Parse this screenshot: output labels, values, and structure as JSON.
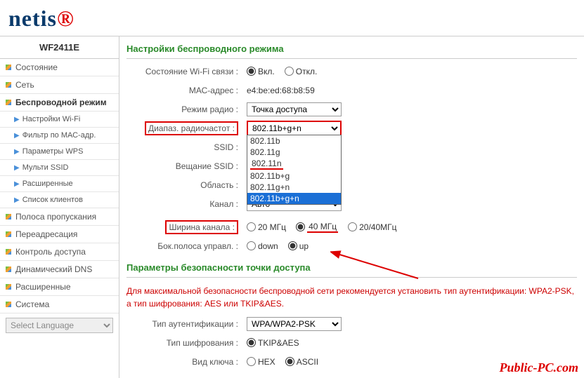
{
  "logo": {
    "text": "netis"
  },
  "model": "WF2411E",
  "nav": {
    "status": "Состояние",
    "network": "Сеть",
    "wireless": "Беспроводной режим",
    "wifi_settings": "Настройки Wi-Fi",
    "mac_filter": "Фильтр по МАС-адр.",
    "wps": "Параметры WPS",
    "multi_ssid": "Мульти SSID",
    "advanced_w": "Расширенные",
    "clients": "Список клиентов",
    "bandwidth": "Полоса пропускания",
    "forwarding": "Переадресация",
    "access": "Контроль доступа",
    "ddns": "Динамический DNS",
    "advanced": "Расширенные",
    "system": "Система"
  },
  "lang_placeholder": "Select Language",
  "sec_wireless": "Настройки беспроводного режима",
  "labels": {
    "wifi_state": "Состояние Wi-Fi связи :",
    "mac": "МАС-адрес :",
    "radio_mode": "Режим радио :",
    "band": "Диапаз. радиочастот :",
    "ssid": "SSID :",
    "ssid_bcast": "Вещание SSID :",
    "region": "Область :",
    "channel": "Канал :",
    "ch_width": "Ширина канала :",
    "sideband": "Бок.полоса управл. :"
  },
  "radio_on": "Вкл.",
  "radio_off": "Откл.",
  "mac_value": "e4:be:ed:68:b8:59",
  "mode_value": "Точка доступа",
  "band_value": "802.11b+g+n",
  "band_options": {
    "o1": "802.11b",
    "o2": "802.11g",
    "o3": "802.11n",
    "o4": "802.11b+g",
    "o5": "802.11g+n",
    "o6": "802.11b+g+n"
  },
  "channel_value": "Авто",
  "cw_20": "20 МГц",
  "cw_40": "40 МГц",
  "cw_2040": "20/40МГц",
  "sb_down": "down",
  "sb_up": "up",
  "sec_security": "Параметры безопасности точки доступа",
  "security_note": "Для максимальной безопасности беспроводной сети рекомендуется установить тип аутентификации: WPA2-PSK, а тип шифрования: AES или TKIP&AES.",
  "labels2": {
    "auth": "Тип аутентификации :",
    "enc": "Тип шифрования :",
    "keytype": "Вид ключа :"
  },
  "auth_value": "WPA/WPA2-PSK",
  "enc_value": "TKIP&AES",
  "key_hex": "HEX",
  "key_ascii": "ASCII",
  "watermark": "Public-PC.com"
}
